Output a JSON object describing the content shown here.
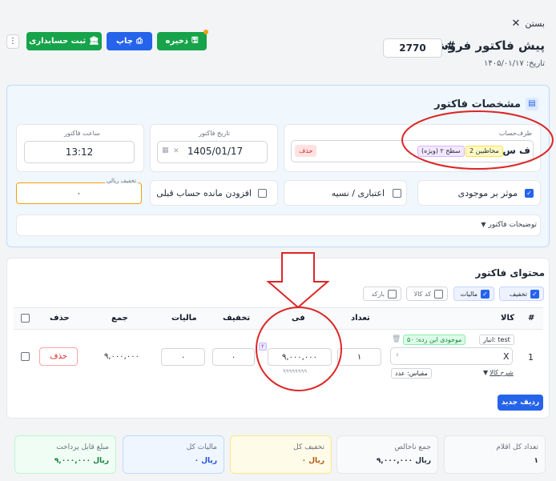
{
  "header": {
    "close_label": "بستن",
    "title": "پیش فاکتور فروش",
    "hash": "#",
    "invoice_number": "2770",
    "date_label": "تاریخ:",
    "date_value": "۱۴۰۵/۰۱/۱۷",
    "save_label": "ذخیره",
    "print_label": "چاپ",
    "accounting_label": "ثبت حسابداری"
  },
  "specs": {
    "title": "مشخصات فاکتور",
    "account_label": "طرف‌حساب",
    "account_name": "ف س",
    "tag_audience": "مخاطبین 2",
    "tag_level": "سطح ۲ (ویژه)",
    "delete_label": "حذف",
    "date_label": "تاریخ فاکتور",
    "date_value": "1405/01/17",
    "time_label": "ساعت فاکتور",
    "time_value": "13:12",
    "inventory_label": "موثر بر موجودی",
    "credit_label": "اعتباری / نسیه",
    "add_balance_label": "افزودن مانده حساب قبلی",
    "rial_discount_label": "تخفیف ریالی",
    "rial_discount_value": "۰",
    "description_label": "توضیحات فاکتور"
  },
  "content": {
    "title": "محتوای فاکتور",
    "toggles": {
      "discount": "تخفیف",
      "tax": "مالیات",
      "code": "کد کالا",
      "barcode": "بارکد"
    },
    "columns": {
      "hash": "#",
      "product": "کالا",
      "qty": "تعداد",
      "price": "فی",
      "discount": "تخفیف",
      "tax": "مالیات",
      "total": "جمع",
      "delete": "حذف"
    },
    "row": {
      "index": "1",
      "warehouse": "انبار: test",
      "stock": "موجودی این رده: ۵۰",
      "product_value": "X",
      "description_link": "شرح کالا",
      "unit": "مقیاس: عدد",
      "qty": "۱",
      "price": "۹,۰۰۰,۰۰۰",
      "price_badge": "۲",
      "price_hint": "۹۹۹۹۹۹۹۹",
      "discount": "۰",
      "tax": "۰",
      "total": "۹,۰۰۰,۰۰۰",
      "delete": "حذف"
    },
    "new_row_label": "ردیف جدید"
  },
  "summary": {
    "items_label": "تعداد کل اقلام",
    "items_value": "۱",
    "gross_label": "جمع ناخالص",
    "gross_value": "۹,۰۰۰,۰۰۰ ریال",
    "discount_label": "تخفیف کل",
    "discount_value": "۰ ریال",
    "tax_label": "مالیات کل",
    "tax_value": "۰ ریال",
    "payable_label": "مبلغ قابل پرداخت",
    "payable_value": "۹,۰۰۰,۰۰۰ ریال"
  },
  "colors": {
    "green": "#16a34a",
    "blue": "#2563eb",
    "annotation_red": "#dc2626"
  }
}
